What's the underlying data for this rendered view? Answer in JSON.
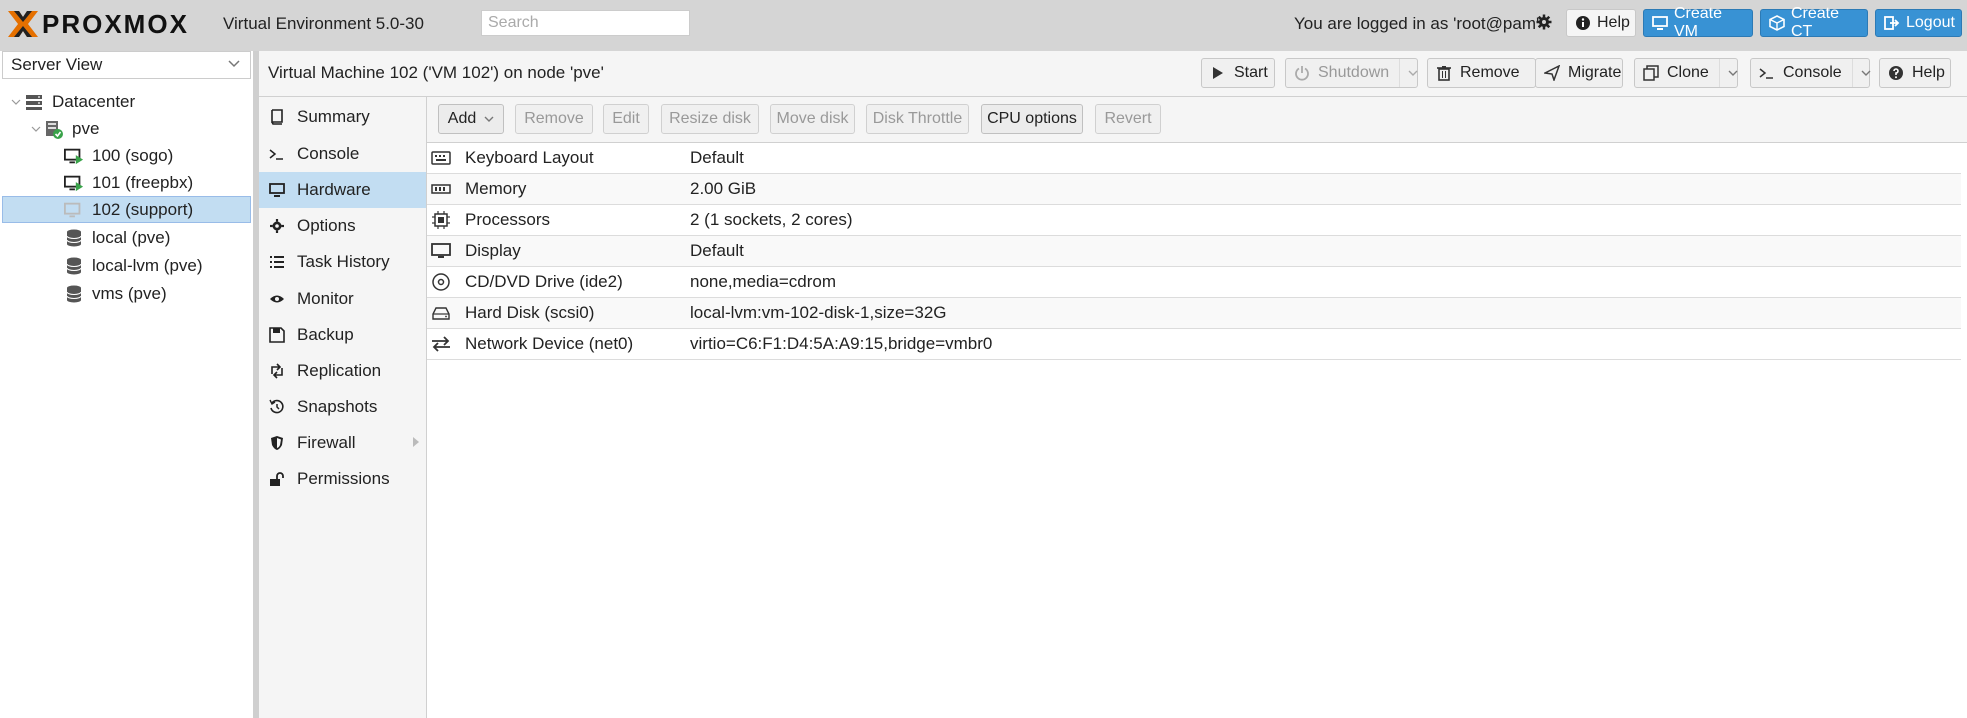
{
  "app": {
    "brand": "PROXMOX",
    "version_label": "Virtual Environment 5.0-30",
    "search_placeholder": "Search",
    "logged_in_text": "You are logged in as 'root@pam'"
  },
  "top_buttons": {
    "help": "Help",
    "create_vm": "Create VM",
    "create_ct": "Create CT",
    "logout": "Logout"
  },
  "tree": {
    "view": "Server View",
    "items": [
      {
        "label": "Datacenter",
        "icon": "datacenter-icon"
      },
      {
        "label": "pve",
        "icon": "node-online-icon"
      },
      {
        "label": "100 (sogo)",
        "icon": "vm-running-icon"
      },
      {
        "label": "101 (freepbx)",
        "icon": "vm-running-icon"
      },
      {
        "label": "102 (support)",
        "icon": "vm-stopped-icon"
      },
      {
        "label": "local (pve)",
        "icon": "storage-icon"
      },
      {
        "label": "local-lvm (pve)",
        "icon": "storage-icon"
      },
      {
        "label": "vms (pve)",
        "icon": "storage-icon"
      }
    ]
  },
  "header": {
    "title": "Virtual Machine 102 ('VM 102') on node 'pve'",
    "buttons": {
      "start": "Start",
      "shutdown": "Shutdown",
      "remove": "Remove",
      "migrate": "Migrate",
      "clone": "Clone",
      "console": "Console",
      "help": "Help"
    }
  },
  "nav": {
    "items": [
      {
        "label": "Summary",
        "icon": "book-icon"
      },
      {
        "label": "Console",
        "icon": "terminal-icon"
      },
      {
        "label": "Hardware",
        "icon": "desktop-icon"
      },
      {
        "label": "Options",
        "icon": "gear-icon"
      },
      {
        "label": "Task History",
        "icon": "list-icon"
      },
      {
        "label": "Monitor",
        "icon": "eye-icon"
      },
      {
        "label": "Backup",
        "icon": "floppy-icon"
      },
      {
        "label": "Replication",
        "icon": "retweet-icon"
      },
      {
        "label": "Snapshots",
        "icon": "history-icon"
      },
      {
        "label": "Firewall",
        "icon": "shield-icon"
      },
      {
        "label": "Permissions",
        "icon": "unlock-icon"
      }
    ],
    "active": "Hardware"
  },
  "toolbar": {
    "add": "Add",
    "remove": "Remove",
    "edit": "Edit",
    "resize_disk": "Resize disk",
    "move_disk": "Move disk",
    "disk_throttle": "Disk Throttle",
    "cpu_options": "CPU options",
    "revert": "Revert"
  },
  "hardware": [
    {
      "key": "Keyboard Layout",
      "value": "Default",
      "icon": "keyboard-icon"
    },
    {
      "key": "Memory",
      "value": "2.00 GiB",
      "icon": "memory-icon"
    },
    {
      "key": "Processors",
      "value": "2 (1 sockets, 2 cores)",
      "icon": "cpu-icon"
    },
    {
      "key": "Display",
      "value": "Default",
      "icon": "display-icon"
    },
    {
      "key": "CD/DVD Drive (ide2)",
      "value": "none,media=cdrom",
      "icon": "cdrom-icon"
    },
    {
      "key": "Hard Disk (scsi0)",
      "value": "local-lvm:vm-102-disk-1,size=32G",
      "icon": "harddisk-icon"
    },
    {
      "key": "Network Device (net0)",
      "value": "virtio=C6:F1:D4:5A:A9:15,bridge=vmbr0",
      "icon": "network-icon"
    }
  ],
  "colors": {
    "accent_blue": "#3892d4",
    "selection": "#c2ddf2",
    "logo_orange": "#e57000",
    "running_green": "#3aa34a"
  }
}
